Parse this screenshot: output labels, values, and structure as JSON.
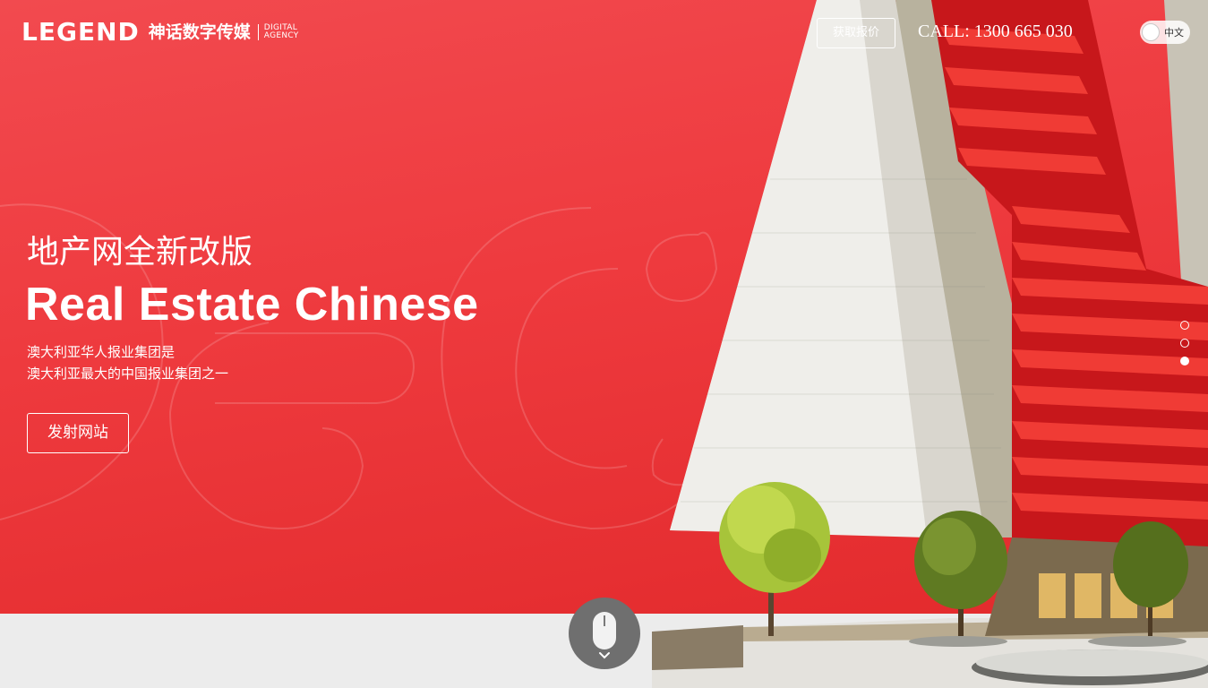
{
  "header": {
    "logo_word": "LEGEND",
    "logo_cn": "神话数字传媒",
    "logo_sub_1": "DIGITAL",
    "logo_sub_2": "AGENCY",
    "quote_button": "获取报价",
    "call": "CALL: 1300 665 030",
    "lang_label": "中文"
  },
  "hero": {
    "title_cn": "地产网全新改版",
    "title_en": "Real Estate Chinese",
    "desc_line1": "澳大利亚华人报业集团是",
    "desc_line2": "澳大利亚最大的中国报业集团之一",
    "cta": "发射网站"
  },
  "slides": {
    "count": 3,
    "active_index": 2
  },
  "colors": {
    "hero_red": "#ee3a3e",
    "text_white": "#ffffff",
    "footer_gray": "#ececec",
    "building_red": "#d9201c"
  },
  "icons": {
    "scroll": "mouse-icon",
    "scroll_arrow": "chevron-down-icon"
  }
}
